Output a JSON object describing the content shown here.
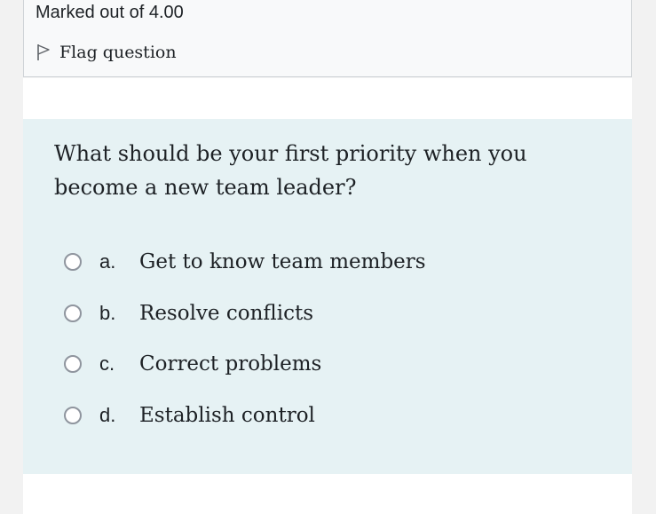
{
  "info": {
    "marked_out_of": "Marked out of 4.00",
    "flag_label": "Flag question"
  },
  "question": {
    "text": "What should be your first priority when you become a new team leader?",
    "options": [
      {
        "letter": "a.",
        "label": "Get to know team members"
      },
      {
        "letter": "b.",
        "label": "Resolve conflicts"
      },
      {
        "letter": "c.",
        "label": "Correct problems"
      },
      {
        "letter": "d.",
        "label": "Establish control"
      }
    ]
  }
}
